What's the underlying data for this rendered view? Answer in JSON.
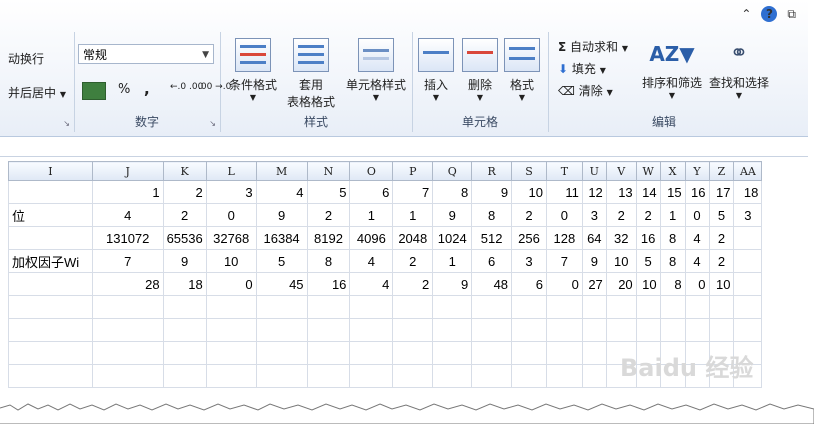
{
  "ribbon": {
    "alignment_partial": {
      "wrap": "动换行",
      "merge": "并后居中"
    },
    "number": {
      "format": "常规",
      "percent": "%",
      "comma": ",",
      "increase_decimal": "←.0 .00",
      "decrease_decimal": ".00 →.0",
      "group_label": "数字"
    },
    "styles": {
      "conditional": "条件格式",
      "table_1": "套用",
      "table_2": "表格格式",
      "cell_styles": "单元格样式",
      "group_label": "样式"
    },
    "cells": {
      "insert": "插入",
      "delete": "删除",
      "format": "格式",
      "group_label": "单元格"
    },
    "editing": {
      "autosum": "自动求和",
      "fill": "填充",
      "clear": "清除",
      "sort": "排序和筛选",
      "find": "查找和选择",
      "group_label": "编辑"
    }
  },
  "sheet": {
    "columns": [
      "I",
      "J",
      "K",
      "L",
      "M",
      "N",
      "O",
      "P",
      "Q",
      "R",
      "S",
      "T",
      "U",
      "V",
      "W",
      "X",
      "Y",
      "Z",
      "AA"
    ],
    "rows": [
      [
        "",
        "1",
        "2",
        "3",
        "4",
        "5",
        "6",
        "7",
        "8",
        "9",
        "10",
        "11",
        "12",
        "13",
        "14",
        "15",
        "16",
        "17",
        "18"
      ],
      [
        "位",
        "4",
        "2",
        "0",
        "9",
        "2",
        "1",
        "1",
        "9",
        "8",
        "2",
        "0",
        "3",
        "2",
        "2",
        "1",
        "0",
        "5",
        "3"
      ],
      [
        "",
        "131072",
        "65536",
        "32768",
        "16384",
        "8192",
        "4096",
        "2048",
        "1024",
        "512",
        "256",
        "128",
        "64",
        "32",
        "16",
        "8",
        "4",
        "2",
        ""
      ],
      [
        "加权因子Wi",
        "7",
        "9",
        "10",
        "5",
        "8",
        "4",
        "2",
        "1",
        "6",
        "3",
        "7",
        "9",
        "10",
        "5",
        "8",
        "4",
        "2",
        ""
      ],
      [
        "",
        "28",
        "18",
        "0",
        "45",
        "16",
        "4",
        "2",
        "9",
        "48",
        "6",
        "0",
        "27",
        "20",
        "10",
        "8",
        "0",
        "10",
        ""
      ],
      [
        "",
        "",
        "",
        "",
        "",
        "",
        "",
        "",
        "",
        "",
        "",
        "",
        "",
        "",
        "",
        "",
        "",
        "",
        ""
      ],
      [
        "",
        "",
        "",
        "",
        "",
        "",
        "",
        "",
        "",
        "",
        "",
        "",
        "",
        "",
        "",
        "",
        "",
        "",
        ""
      ],
      [
        "",
        "",
        "",
        "",
        "",
        "",
        "",
        "",
        "",
        "",
        "",
        "",
        "",
        "",
        "",
        "",
        "",
        "",
        ""
      ],
      [
        "",
        "",
        "",
        "",
        "",
        "",
        "",
        "",
        "",
        "",
        "",
        "",
        "",
        "",
        "",
        "",
        "",
        "",
        ""
      ]
    ]
  },
  "watermark": "Baidu 经验"
}
